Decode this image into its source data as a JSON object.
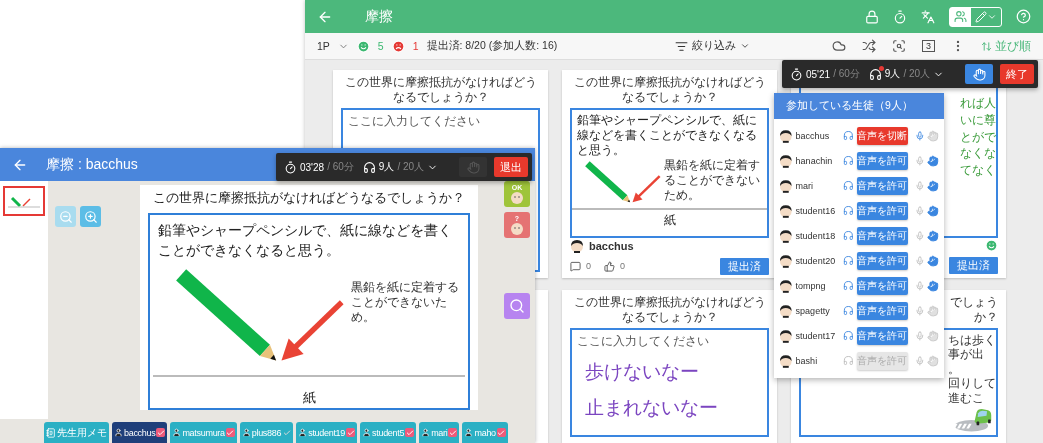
{
  "teacher_window": {
    "title": "摩擦",
    "mode_toggle": [
      {
        "kind": "users",
        "selected": true
      },
      {
        "kind": "pencil",
        "selected": false
      }
    ],
    "toolbar": {
      "page": "1P",
      "good_count": "5",
      "bad_count": "1",
      "submitted": "提出済: 8/20 (参加人数: 16)",
      "filter": "絞り込み",
      "page_count": "3",
      "sort": "並び順"
    },
    "session_bar": {
      "elapsed": "05'21",
      "limit": "/ 60分",
      "listeners": "9人",
      "total": "/ 20人",
      "end_button": "終了"
    },
    "cards": [
      {
        "kind": "empty",
        "question": "この世界に摩擦抵抗がなければどうなるでしょうか？",
        "placeholder": "ここに入力してください"
      },
      {
        "kind": "drawing",
        "question": "この世界に摩擦抵抗がなければどうなるでしょうか？",
        "answer": "鉛筆やシャープペンシルで、紙に線などを書くことができなくなると思う。",
        "note": "黒鉛を紙に定着することができないため。",
        "label": "紙",
        "author": "bacchus",
        "comments": "0",
        "likes": "0",
        "status": "提出済"
      },
      {
        "kind": "text",
        "lines": [
          "れば人",
          "いに尊",
          "とがで",
          "なくな",
          "てなく"
        ],
        "status": "提出済"
      },
      {
        "kind": "covered"
      },
      {
        "kind": "handwriting",
        "question": "この世界に摩擦抵抗がなければどうなるでしょうか？",
        "placeholder": "ここに入力してください",
        "lines": [
          "歩けないなー",
          "止まれないなー"
        ]
      },
      {
        "kind": "car",
        "question": "でしょうか？",
        "lines": [
          "ちは歩く事が出",
          "。",
          "回りして進むこ"
        ]
      }
    ],
    "participants": {
      "title": "参加している生徒（9人）",
      "students": [
        {
          "name": "bacchus",
          "kind": "cut",
          "button": "音声を切断",
          "listening": true,
          "mic_on": true,
          "hand_raised": false
        },
        {
          "name": "hanachin",
          "kind": "allow",
          "button": "音声を許可",
          "listening": true,
          "mic_on": false,
          "hand_raised": true
        },
        {
          "name": "mari",
          "kind": "allow",
          "button": "音声を許可",
          "listening": true,
          "mic_on": false,
          "hand_raised": true
        },
        {
          "name": "student16",
          "kind": "allow",
          "button": "音声を許可",
          "listening": true,
          "mic_on": false,
          "hand_raised": true
        },
        {
          "name": "student18",
          "kind": "allow",
          "button": "音声を許可",
          "listening": true,
          "mic_on": false,
          "hand_raised": true
        },
        {
          "name": "student20",
          "kind": "allow",
          "button": "音声を許可",
          "listening": true,
          "mic_on": false,
          "hand_raised": true
        },
        {
          "name": "tompng",
          "kind": "allow",
          "button": "音声を許可",
          "listening": true,
          "mic_on": false,
          "hand_raised": true
        },
        {
          "name": "spagetty",
          "kind": "allow",
          "button": "音声を許可",
          "listening": true,
          "mic_on": false,
          "hand_raised": false
        },
        {
          "name": "student17",
          "kind": "allow",
          "button": "音声を許可",
          "listening": true,
          "mic_on": false,
          "hand_raised": false
        },
        {
          "name": "bashi",
          "kind": "disabled",
          "button": "音声を許可",
          "listening": false,
          "mic_on": false,
          "hand_raised": false
        }
      ]
    }
  },
  "student_window": {
    "title": "摩擦 : bacchus",
    "session_bar": {
      "elapsed": "03'28",
      "limit": "/ 60分",
      "listeners": "9人",
      "total": "/ 20人",
      "leave_button": "退出"
    },
    "sheet": {
      "question": "この世界に摩擦抵抗がなければどうなるでしょうか？",
      "answer": "鉛筆やシャープペンシルで、紙に線などを書くことができなくなると思う。",
      "note": "黒鉛を紙に定着することができないため。",
      "label": "紙"
    },
    "reactions": [
      {
        "kind": "ok",
        "label": "OK"
      },
      {
        "kind": "question",
        "label": "?"
      },
      {
        "kind": "search"
      }
    ],
    "tabs": [
      {
        "kind": "memo",
        "label": "先生用メモ",
        "selected": false
      },
      {
        "kind": "student",
        "label": "bacchus",
        "selected": true,
        "checked": true
      },
      {
        "kind": "student",
        "label": "matsumura",
        "selected": false,
        "checked": true
      },
      {
        "kind": "student",
        "label": "plus886",
        "selected": false,
        "checked": false
      },
      {
        "kind": "student",
        "label": "student19",
        "selected": false,
        "checked": true
      },
      {
        "kind": "student",
        "label": "student5",
        "selected": false,
        "checked": true
      },
      {
        "kind": "student",
        "label": "mari",
        "selected": false,
        "checked": true
      },
      {
        "kind": "student",
        "label": "maho",
        "selected": false,
        "checked": true
      }
    ]
  }
}
